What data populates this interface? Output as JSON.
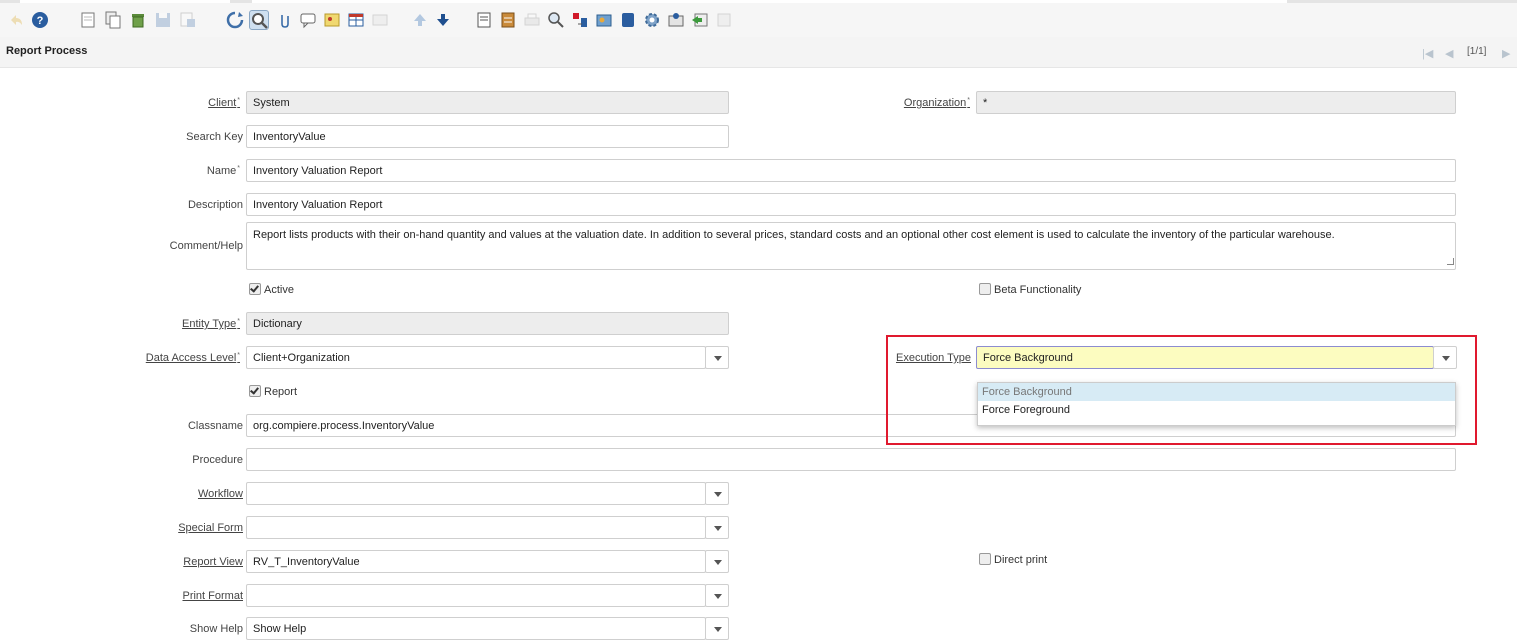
{
  "toolbar": {
    "icons": [
      "undo-icon",
      "help-icon",
      "new-record-icon",
      "copy-record-icon",
      "delete-icon",
      "save-icon",
      "save-new-icon",
      "refresh-icon",
      "find-icon",
      "attachment-icon",
      "chat-icon",
      "archive-icon",
      "toggle-grid-icon",
      "history-icon",
      "previous-record-icon",
      "next-record-icon",
      "report-icon",
      "archived-documents-icon",
      "print-icon",
      "zoom-across-icon",
      "requests-icon",
      "product-info-icon",
      "active-workflows-icon",
      "process-icon",
      "customize-icon",
      "export-icon",
      "close-icon"
    ]
  },
  "window": {
    "title": "Report Process",
    "record_counter": "[1/1]"
  },
  "form": {
    "client": {
      "label": "Client",
      "value": "System"
    },
    "organization": {
      "label": "Organization",
      "value": "*"
    },
    "search_key": {
      "label": "Search Key",
      "value": "InventoryValue"
    },
    "name": {
      "label": "Name",
      "value": "Inventory Valuation Report"
    },
    "description": {
      "label": "Description",
      "value": "Inventory Valuation Report"
    },
    "comment_help": {
      "label": "Comment/Help",
      "value": "Report lists products with their on-hand quantity and values at the valuation date. In addition to several prices, standard costs and an optional other cost element is used to calculate the inventory of the particular warehouse."
    },
    "active": {
      "label": "Active",
      "checked": true
    },
    "beta": {
      "label": "Beta Functionality",
      "checked": false
    },
    "entity_type": {
      "label": "Entity Type",
      "value": "Dictionary"
    },
    "data_access_level": {
      "label": "Data Access Level",
      "value": "Client+Organization"
    },
    "execution_type": {
      "label": "Execution Type",
      "value": "Force Background",
      "options": [
        "Force Background",
        "Force Foreground"
      ]
    },
    "report": {
      "label": "Report",
      "checked": true
    },
    "classname": {
      "label": "Classname",
      "value": "org.compiere.process.InventoryValue"
    },
    "procedure": {
      "label": "Procedure",
      "value": ""
    },
    "workflow": {
      "label": "Workflow",
      "value": ""
    },
    "special_form": {
      "label": "Special Form",
      "value": ""
    },
    "report_view": {
      "label": "Report View",
      "value": "RV_T_InventoryValue"
    },
    "direct_print": {
      "label": "Direct print",
      "checked": false
    },
    "print_format": {
      "label": "Print Format",
      "value": ""
    },
    "show_help": {
      "label": "Show Help",
      "value": "Show Help"
    }
  },
  "colors": {
    "highlight_border": "#e0192e",
    "focused_field_bg": "#fcfcc0",
    "selected_option_bg": "#d7ebf5"
  }
}
